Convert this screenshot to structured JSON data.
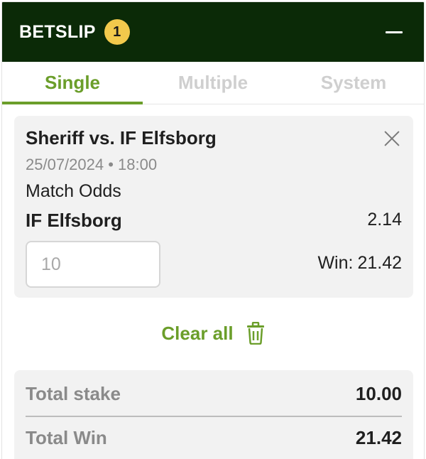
{
  "header": {
    "title": "BETSLIP",
    "count": "1"
  },
  "tabs": [
    {
      "label": "Single",
      "active": true
    },
    {
      "label": "Multiple",
      "active": false
    },
    {
      "label": "System",
      "active": false
    }
  ],
  "bet": {
    "match": "Sheriff vs. IF Elfsborg",
    "datetime": "25/07/2024 • 18:00",
    "market": "Match Odds",
    "selection": "IF Elfsborg",
    "odds": "2.14",
    "stake_placeholder": "10",
    "win_label": "Win:",
    "win_value": "21.42"
  },
  "actions": {
    "clear_all": "Clear all"
  },
  "summary": {
    "total_stake_label": "Total stake",
    "total_stake_value": "10.00",
    "total_win_label": "Total Win",
    "total_win_value": "21.42"
  },
  "colors": {
    "header_bg": "#0b2a07",
    "accent": "#6b9e2a",
    "badge": "#f2c94c"
  },
  "icons": [
    "minimize-icon",
    "close-icon",
    "trash-icon"
  ]
}
